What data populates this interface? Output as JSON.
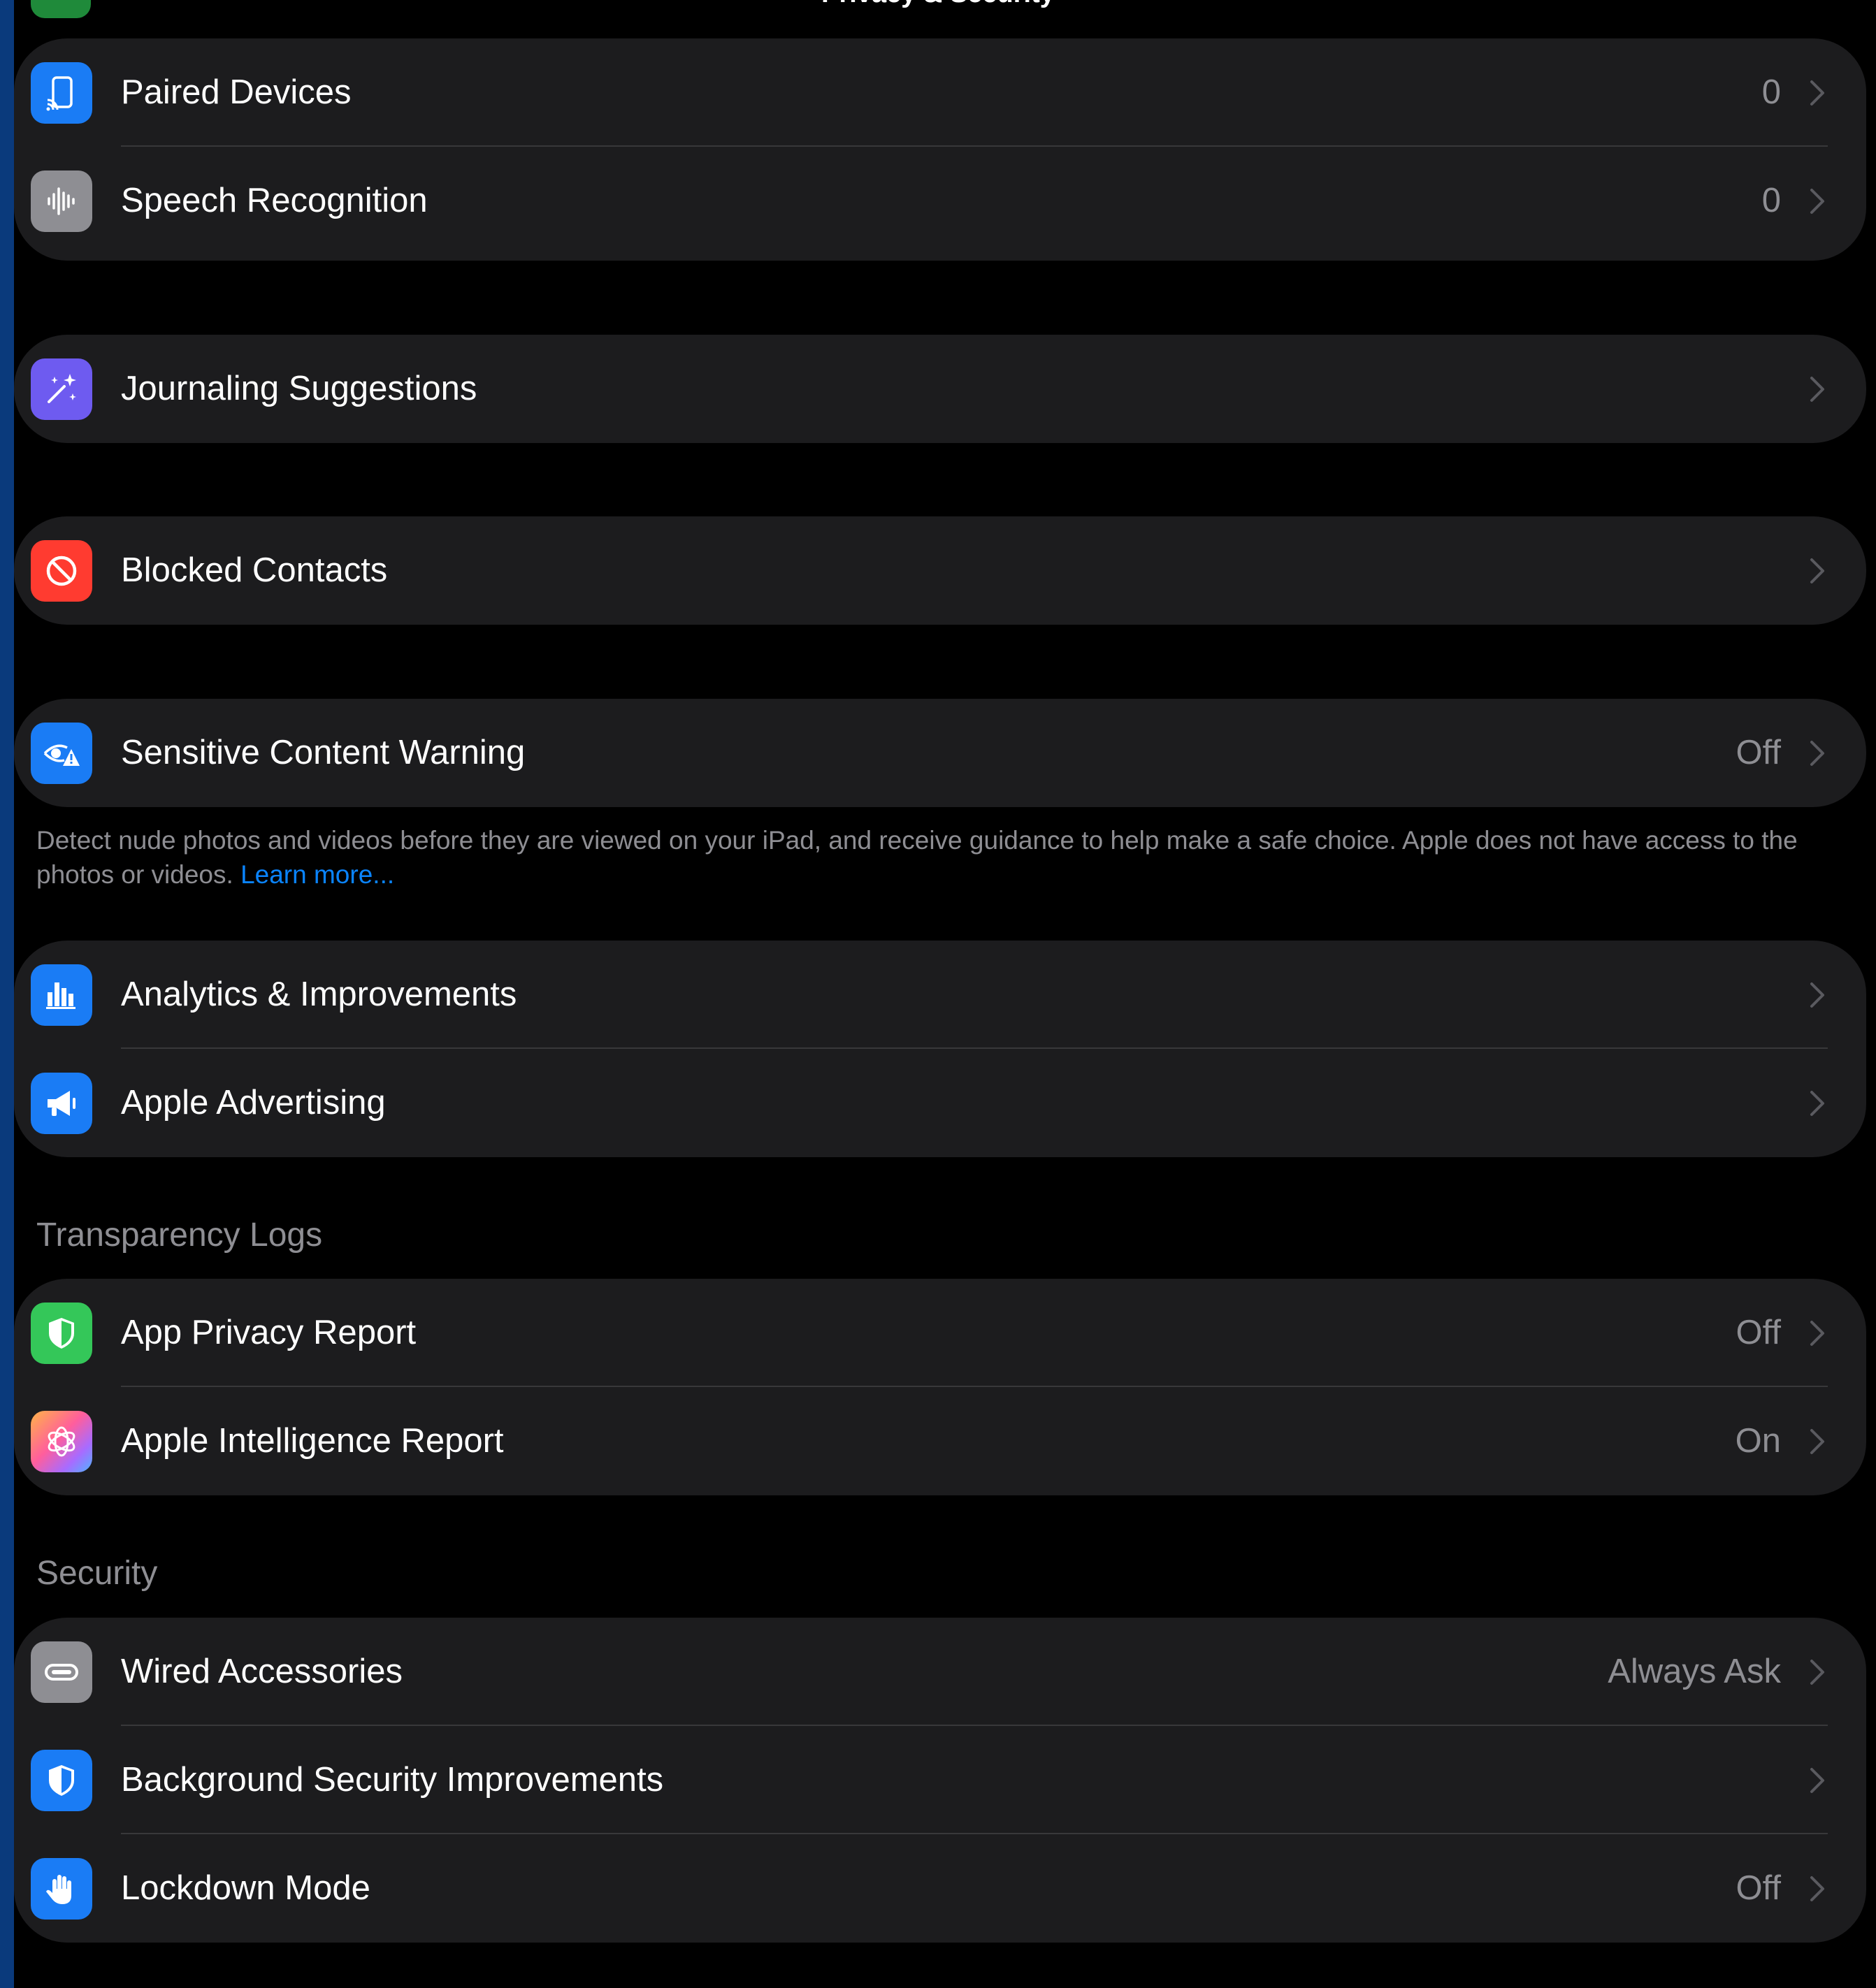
{
  "header": {
    "title": "Privacy & Security"
  },
  "groups": {
    "devices": {
      "paired_devices": {
        "label": "Paired Devices",
        "value": "0",
        "icon": "paired-devices-icon",
        "color": "#1a7cf5"
      },
      "speech_recognition": {
        "label": "Speech Recognition",
        "value": "0",
        "icon": "waveform-icon",
        "color": "#8e8e93"
      }
    },
    "journaling": {
      "journaling_suggestions": {
        "label": "Journaling Suggestions",
        "icon": "magic-wand-icon",
        "color": "#6e5bf0"
      }
    },
    "blocked": {
      "blocked_contacts": {
        "label": "Blocked Contacts",
        "icon": "blocked-icon",
        "color": "#ff3b30"
      }
    },
    "sensitive": {
      "sensitive_content_warning": {
        "label": "Sensitive Content Warning",
        "value": "Off",
        "icon": "eye-warning-icon",
        "color": "#1a7cf5"
      },
      "footer_text": "Detect nude photos and videos before they are viewed on your iPad, and receive guidance to help make a safe choice. Apple does not have access to the photos or videos.",
      "footer_link": "Learn more..."
    },
    "analytics": {
      "analytics_improvements": {
        "label": "Analytics & Improvements",
        "icon": "bar-chart-icon",
        "color": "#1a7cf5"
      },
      "apple_advertising": {
        "label": "Apple Advertising",
        "icon": "megaphone-icon",
        "color": "#1a7cf5"
      }
    },
    "transparency": {
      "header": "Transparency Logs",
      "app_privacy_report": {
        "label": "App Privacy Report",
        "value": "Off",
        "icon": "shield-icon",
        "color": "#34c759"
      },
      "apple_intelligence_report": {
        "label": "Apple Intelligence Report",
        "value": "On",
        "icon": "apple-intelligence-icon",
        "color": "#ff6b9d"
      }
    },
    "security": {
      "header": "Security",
      "wired_accessories": {
        "label": "Wired Accessories",
        "value": "Always Ask",
        "icon": "cable-icon",
        "color": "#8e8e93"
      },
      "background_security": {
        "label": "Background Security Improvements",
        "icon": "shield-icon",
        "color": "#1a7cf5"
      },
      "lockdown_mode": {
        "label": "Lockdown Mode",
        "value": "Off",
        "icon": "hand-icon",
        "color": "#1a7cf5"
      }
    }
  }
}
